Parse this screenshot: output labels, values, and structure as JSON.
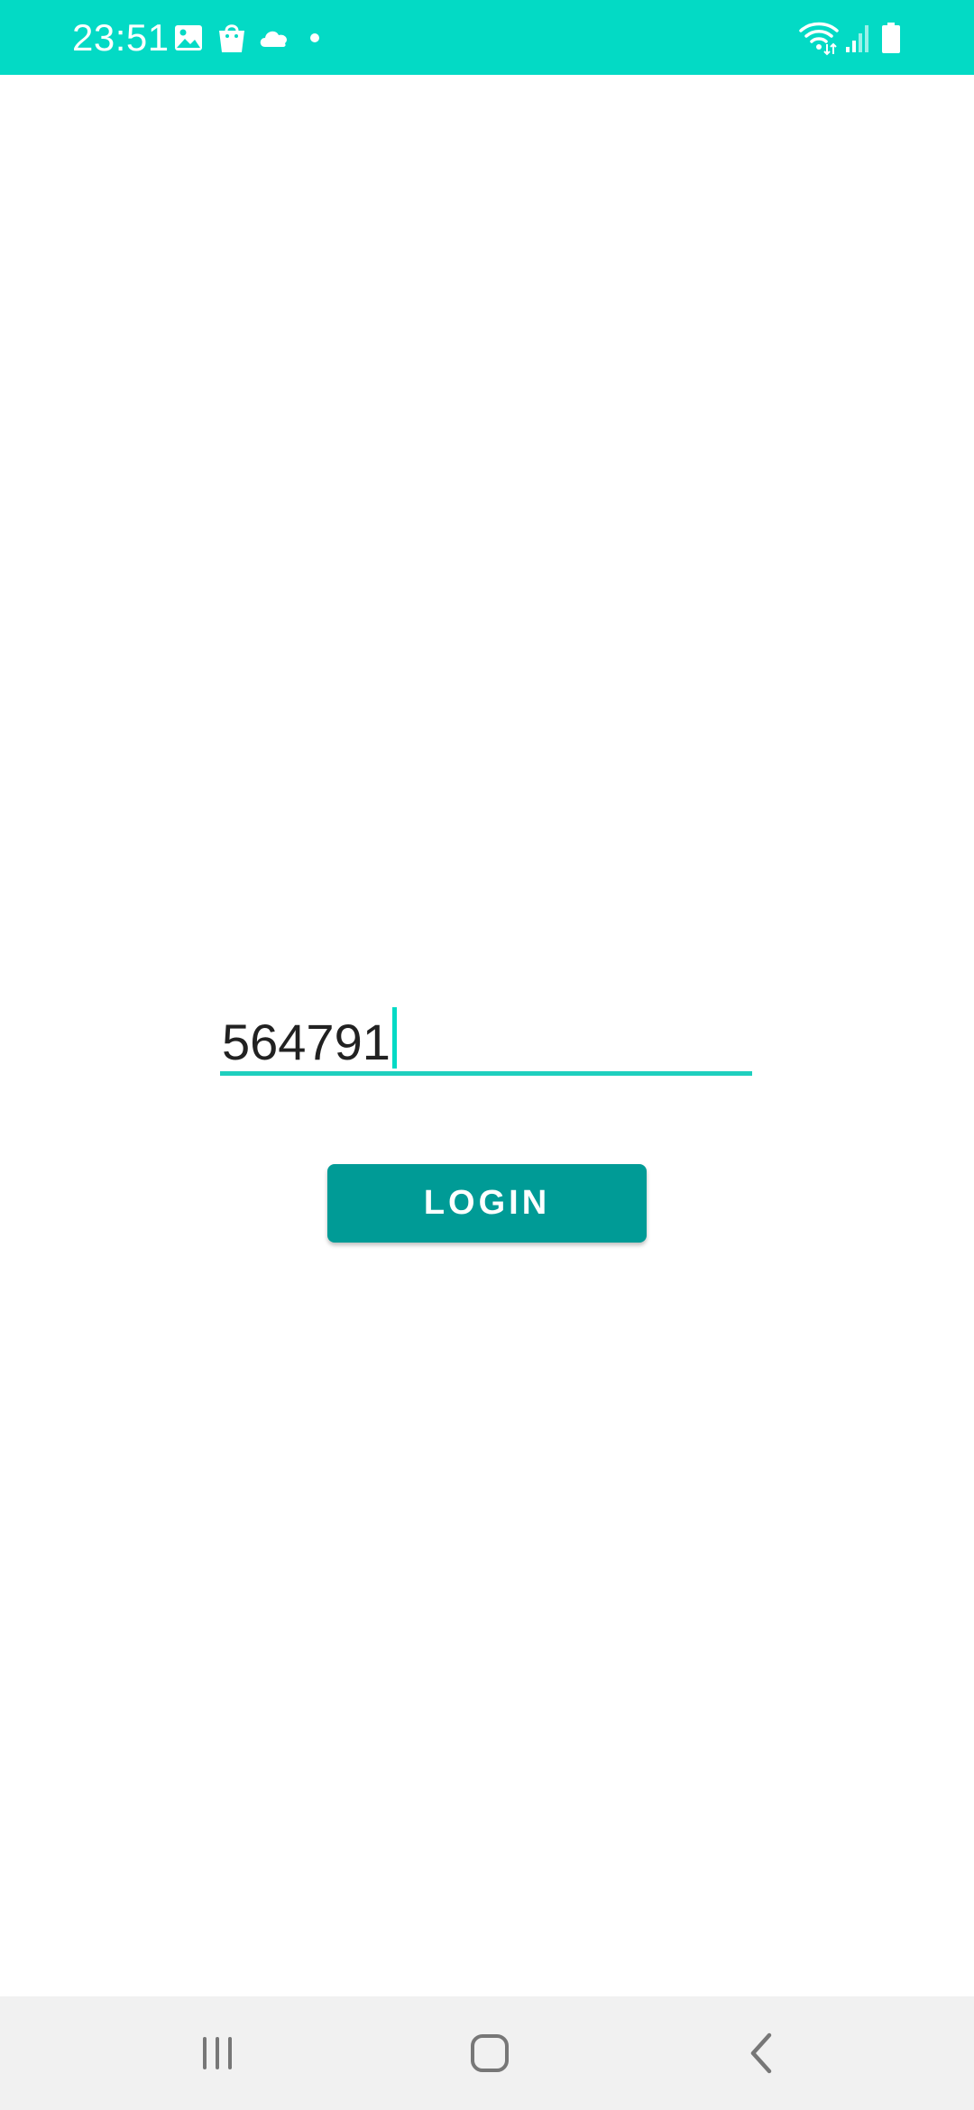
{
  "status_bar": {
    "time": "23:51",
    "background": "#03dac5",
    "notification_icons": [
      "image-icon",
      "shopping-bag-icon",
      "cloud-icon",
      "dot-icon"
    ],
    "system_icons": [
      "wifi-icon",
      "signal-icon",
      "battery-icon"
    ]
  },
  "login_form": {
    "code_value": "564791",
    "accent_color": "#03dac5",
    "login_label": "LOGIN",
    "button_color": "#009b96"
  },
  "nav_bar": {
    "buttons": [
      "recent-apps-icon",
      "home-icon",
      "back-icon"
    ]
  }
}
